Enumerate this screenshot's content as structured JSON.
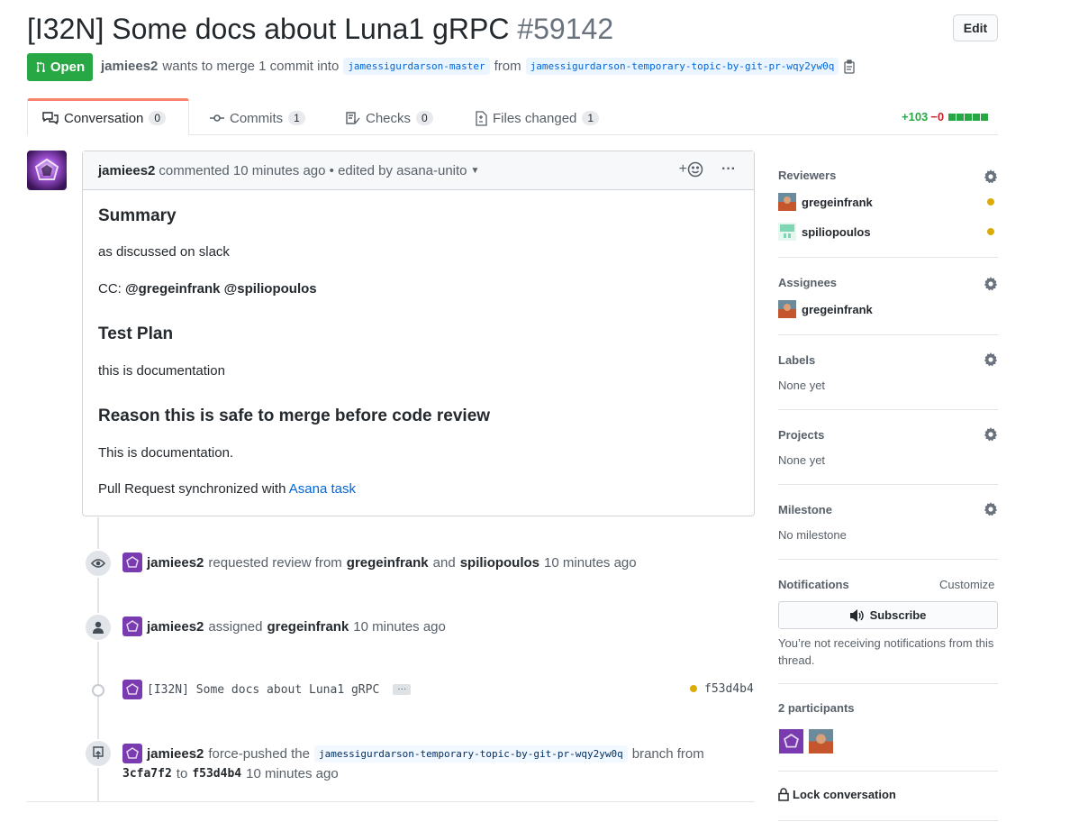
{
  "pr": {
    "title": "[I32N] Some docs about Luna1 gRPC",
    "number": "#59142",
    "edit_label": "Edit",
    "state": "Open",
    "author": "jamiees2",
    "merge_text": "wants to merge 1 commit into",
    "base_branch": "jamessigurdarson-master",
    "from_text": "from",
    "head_branch": "jamessigurdarson-temporary-topic-by-git-pr-wqy2yw0q"
  },
  "tabs": [
    {
      "label": "Conversation",
      "count": "0"
    },
    {
      "label": "Commits",
      "count": "1"
    },
    {
      "label": "Checks",
      "count": "0"
    },
    {
      "label": "Files changed",
      "count": "1"
    }
  ],
  "diffstat": {
    "added": "+103",
    "removed": "−0"
  },
  "comment": {
    "author": "jamiees2",
    "meta": "commented 10 minutes ago • edited by asana-unito",
    "react": "+",
    "more": "···",
    "summary_heading": "Summary",
    "summary_text": "as discussed on slack",
    "cc_prefix": "CC:",
    "cc_mentions": "@gregeinfrank @spiliopoulos",
    "testplan_heading": "Test Plan",
    "testplan_text": "this is documentation",
    "reason_heading": "Reason this is safe to merge before code review",
    "reason_text": "This is documentation.",
    "sync_text": "Pull Request synchronized with",
    "sync_link": "Asana task"
  },
  "timeline": {
    "review": {
      "actor": "jamiees2",
      "text1": "requested review from",
      "user1": "gregeinfrank",
      "and": "and",
      "user2": "spiliopoulos",
      "time": "10 minutes ago"
    },
    "assign": {
      "actor": "jamiees2",
      "text": "assigned",
      "user": "gregeinfrank",
      "time": "10 minutes ago"
    },
    "commit": {
      "message": "[I32N] Some docs about Luna1 gRPC",
      "ellipsis": "···",
      "sha": "f53d4b4"
    },
    "push": {
      "actor": "jamiees2",
      "text": "force-pushed the",
      "branch": "jamessigurdarson-temporary-topic-by-git-pr-wqy2yw0q",
      "branch_text": "branch from",
      "from_sha": "3cfa7f2",
      "to": "to",
      "to_sha": "f53d4b4",
      "time": "10 minutes ago"
    }
  },
  "sidebar": {
    "reviewers_title": "Reviewers",
    "reviewers": [
      "gregeinfrank",
      "spiliopoulos"
    ],
    "assignees_title": "Assignees",
    "assignee": "gregeinfrank",
    "labels_title": "Labels",
    "labels_value": "None yet",
    "projects_title": "Projects",
    "projects_value": "None yet",
    "milestone_title": "Milestone",
    "milestone_value": "No milestone",
    "notifications_title": "Notifications",
    "customize": "Customize",
    "subscribe": "Subscribe",
    "notif_text": "You’re not receiving notifications from this thread.",
    "participants": "2 participants",
    "lock": "Lock conversation"
  },
  "colors": {
    "open": "#28a745",
    "link": "#0366d6",
    "pending": "#dbab09"
  }
}
